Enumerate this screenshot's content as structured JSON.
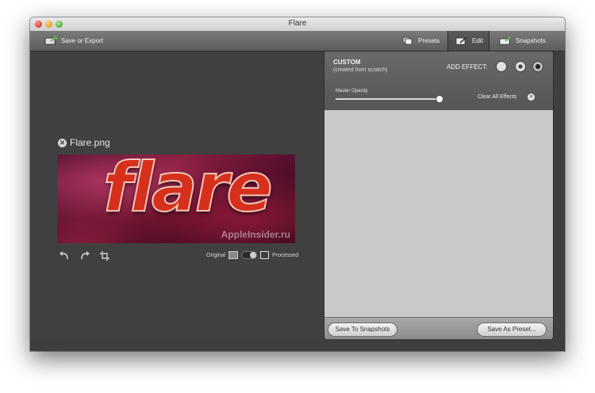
{
  "window": {
    "title": "Flare"
  },
  "toolbar": {
    "save_export": "Save or Export",
    "presets": "Presets",
    "edit": "Edit",
    "snapshots": "Snapshots",
    "selected": "Edit"
  },
  "stage": {
    "filename": "Flare.png",
    "close_glyph": "✕",
    "preview_text": "flare",
    "watermark": "AppleInsider.ru",
    "original_label": "Original",
    "processed_label": "Processed",
    "toggle_state": "processed"
  },
  "panel": {
    "title": "CUSTOM",
    "subtitle": "(created from scratch)",
    "add_effect_label": "ADD EFFECT:",
    "master_opacity_label": "Master Opacity",
    "master_opacity_value": 1,
    "clear_all_label": "Clear All Effects",
    "save_snapshot_label": "Save To Snapshots",
    "save_preset_label": "Save As Preset..."
  },
  "icons": {
    "save_export": "save-export-icon",
    "presets": "presets-icon",
    "edit": "edit-icon",
    "snapshots": "snapshots-icon",
    "undo": "undo-icon",
    "redo": "redo-icon",
    "crop": "crop-icon",
    "effect_1": "effect-color-icon",
    "effect_2": "effect-gear-icon",
    "effect_3": "effect-burst-icon"
  },
  "colors": {
    "stage_bg": "#404040",
    "panel_bg": "#c9c9c9",
    "preview_text": "#d6301c"
  }
}
